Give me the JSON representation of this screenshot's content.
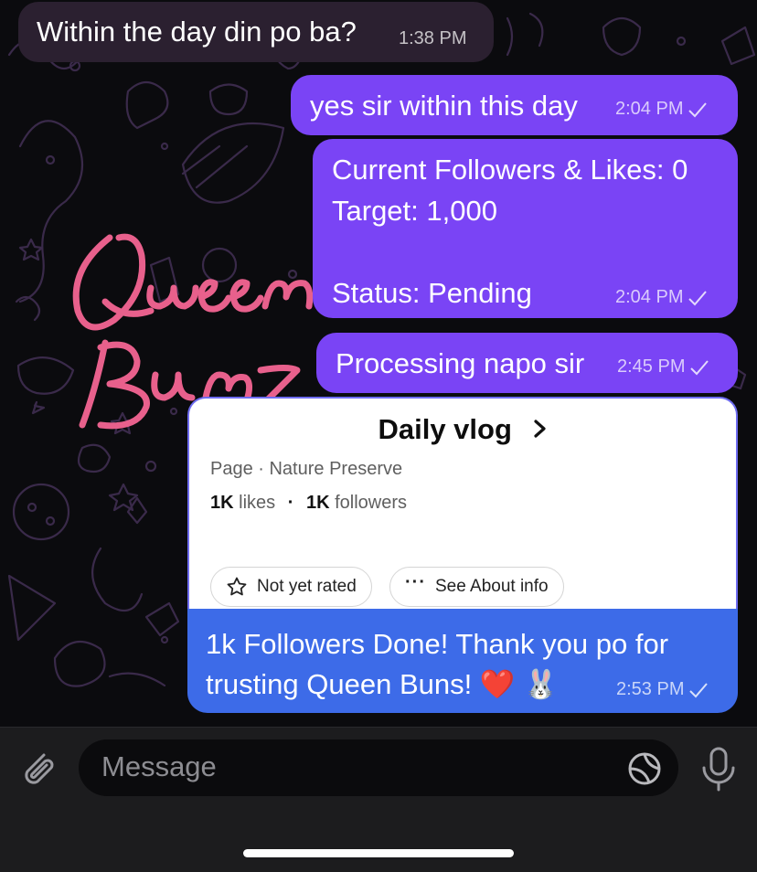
{
  "messages": [
    {
      "id": "m1",
      "direction": "incoming",
      "text": "Within the day din po ba?",
      "time": "1:38 PM"
    },
    {
      "id": "m2",
      "direction": "outgoing",
      "text": "yes sir within this day",
      "time": "2:04 PM"
    },
    {
      "id": "m3",
      "direction": "outgoing",
      "lines": [
        "Current Followers & Likes: 0",
        "Target: 1,000",
        "",
        "Status: Pending"
      ],
      "time": "2:04 PM"
    },
    {
      "id": "m4",
      "direction": "outgoing",
      "text": "Processing napo sir",
      "time": "2:45 PM"
    },
    {
      "id": "m5",
      "direction": "outgoing",
      "lines": [
        "1k Followers Done! Thank you po for",
        "trusting Queen Buns! ❤️ 🐰"
      ],
      "time": "2:53 PM"
    }
  ],
  "card": {
    "title": "Daily vlog",
    "chevron": "›",
    "category": "Page · Nature Preserve",
    "likes_value": "1K",
    "likes_label": "likes",
    "dot": "·",
    "followers_value": "1K",
    "followers_label": "followers",
    "rating_label": "Not yet rated",
    "about_label": "See About info"
  },
  "watermark": {
    "line1": "Queen",
    "line2": "Buns",
    "color": "#e8608c"
  },
  "composer": {
    "placeholder": "Message"
  },
  "colors": {
    "outgoing": "#7a44f5",
    "outgoing_last": "#3d6be8",
    "incoming": "#2b2030",
    "background": "#0b0b0e"
  },
  "icons": [
    "attach-icon",
    "sticker-icon",
    "microphone-icon",
    "check-icon",
    "star-icon",
    "more-dots-icon",
    "chevron-right-icon"
  ]
}
